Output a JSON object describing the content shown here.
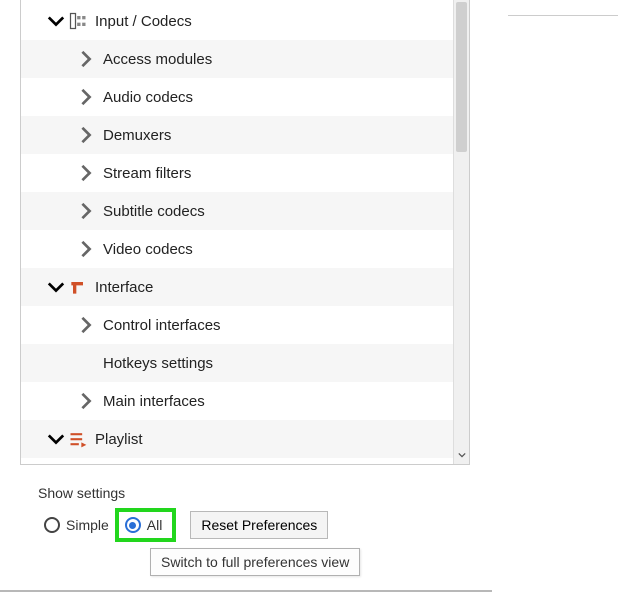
{
  "tree": {
    "input_codecs": {
      "label": "Input / Codecs",
      "expanded": true,
      "children": [
        {
          "label": "Access modules",
          "has_children": true
        },
        {
          "label": "Audio codecs",
          "has_children": true
        },
        {
          "label": "Demuxers",
          "has_children": true
        },
        {
          "label": "Stream filters",
          "has_children": true
        },
        {
          "label": "Subtitle codecs",
          "has_children": true
        },
        {
          "label": "Video codecs",
          "has_children": true
        }
      ]
    },
    "interface": {
      "label": "Interface",
      "expanded": true,
      "children": [
        {
          "label": "Control interfaces",
          "has_children": true
        },
        {
          "label": "Hotkeys settings",
          "has_children": false
        },
        {
          "label": "Main interfaces",
          "has_children": true
        }
      ]
    },
    "playlist": {
      "label": "Playlist",
      "expanded": true
    }
  },
  "footer": {
    "show_settings_label": "Show settings",
    "radio": {
      "simple": "Simple",
      "all": "All",
      "selected": "all"
    },
    "reset_button": "Reset Preferences",
    "tooltip": "Switch to full preferences view"
  }
}
